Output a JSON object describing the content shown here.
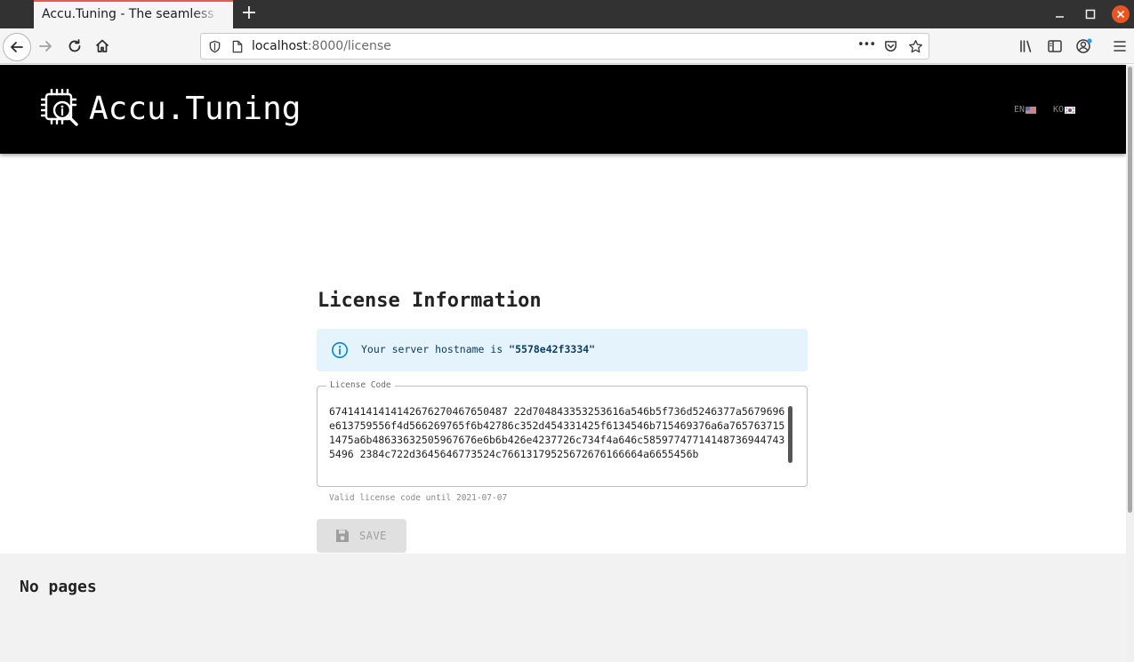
{
  "browser": {
    "tab_title": "Accu.Tuning - The seamless automated machine learning platform",
    "new_tab_glyph": "+",
    "url_host": "localhost",
    "url_rest": ":8000/license",
    "url_actions_glyph": "•••"
  },
  "header": {
    "logo_text": "Accu.Tuning",
    "lang_en": "EN",
    "lang_ko": "KO"
  },
  "page": {
    "title": "License Information",
    "info_prefix": "Your server hostname is ",
    "hostname": "\"5578e42f3334\"",
    "license_field_label": "License Code",
    "license_code": "67414141414142676270467650487 22d704843353253616a546b5f736d5246377a5679696e613759556f4d566269765f6b42786c352d454331425f6134546b715469376a6a7657637151475a6b48633632505967676e6b6b426e4237726c734f4a646c585977477141487369447435496 2384c722d3645646773524c76613179525672676166664a6655456b",
    "helper_text": "Valid license code until 2021-07-07",
    "save_label": "SAVE"
  },
  "footer": {
    "text": "No pages"
  },
  "colors": {
    "header_bg": "#000000",
    "info_bg": "#e5f3fc",
    "info_accent": "#0288d1",
    "tab_accent": "#e55b4d",
    "close_button": "#e95420"
  }
}
